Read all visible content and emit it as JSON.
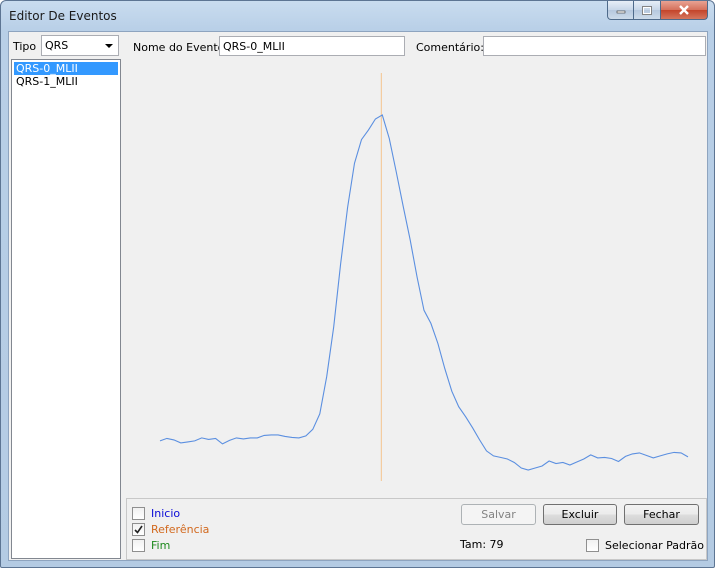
{
  "window": {
    "title": "Editor De Eventos"
  },
  "tipo": {
    "label": "Tipo",
    "selected": "QRS"
  },
  "events": {
    "items": [
      "QRS-0_MLII",
      "QRS-1_MLII"
    ],
    "selected_index": 0
  },
  "nome_evento": {
    "label": "Nome do Evento",
    "value": "QRS-0_MLII"
  },
  "comentario": {
    "label": "Comentário:",
    "value": ""
  },
  "chart_data": {
    "type": "line",
    "title": "",
    "xlabel": "",
    "ylabel": "",
    "grid": false,
    "series": [
      {
        "color": "#5b8fe0",
        "values": [
          0.28,
          0.33,
          0.3,
          0.24,
          0.26,
          0.28,
          0.34,
          0.31,
          0.33,
          0.22,
          0.29,
          0.34,
          0.32,
          0.34,
          0.34,
          0.39,
          0.4,
          0.4,
          0.37,
          0.35,
          0.34,
          0.38,
          0.51,
          0.82,
          1.56,
          2.55,
          3.8,
          4.93,
          5.81,
          6.28,
          6.47,
          6.69,
          6.77,
          6.3,
          5.64,
          4.95,
          4.29,
          3.54,
          2.88,
          2.62,
          2.22,
          1.72,
          1.27,
          0.96,
          0.76,
          0.54,
          0.3,
          0.08,
          -0.02,
          -0.05,
          -0.08,
          -0.15,
          -0.26,
          -0.3,
          -0.26,
          -0.22,
          -0.12,
          -0.17,
          -0.15,
          -0.2,
          -0.14,
          -0.08,
          0.0,
          -0.06,
          -0.05,
          -0.07,
          -0.13,
          -0.03,
          0.02,
          0.04,
          -0.01,
          -0.06,
          -0.02,
          0.02,
          0.05,
          0.04,
          -0.04
        ]
      }
    ],
    "reference_index": 32,
    "reference_color": "#f4c48e"
  },
  "markers": {
    "inicio": {
      "label": "Inicio",
      "color": "#0a0ad6",
      "checked": false
    },
    "referencia": {
      "label": "Referência",
      "color": "#d2691e",
      "checked": true
    },
    "fim": {
      "label": "Fim",
      "color": "#1e8a1e",
      "checked": false
    }
  },
  "buttons": {
    "salvar": "Salvar",
    "excluir": "Excluir",
    "fechar": "Fechar"
  },
  "tam": "Tam: 79",
  "selecionar_padrao": {
    "label": "Selecionar Padrão",
    "checked": false
  }
}
